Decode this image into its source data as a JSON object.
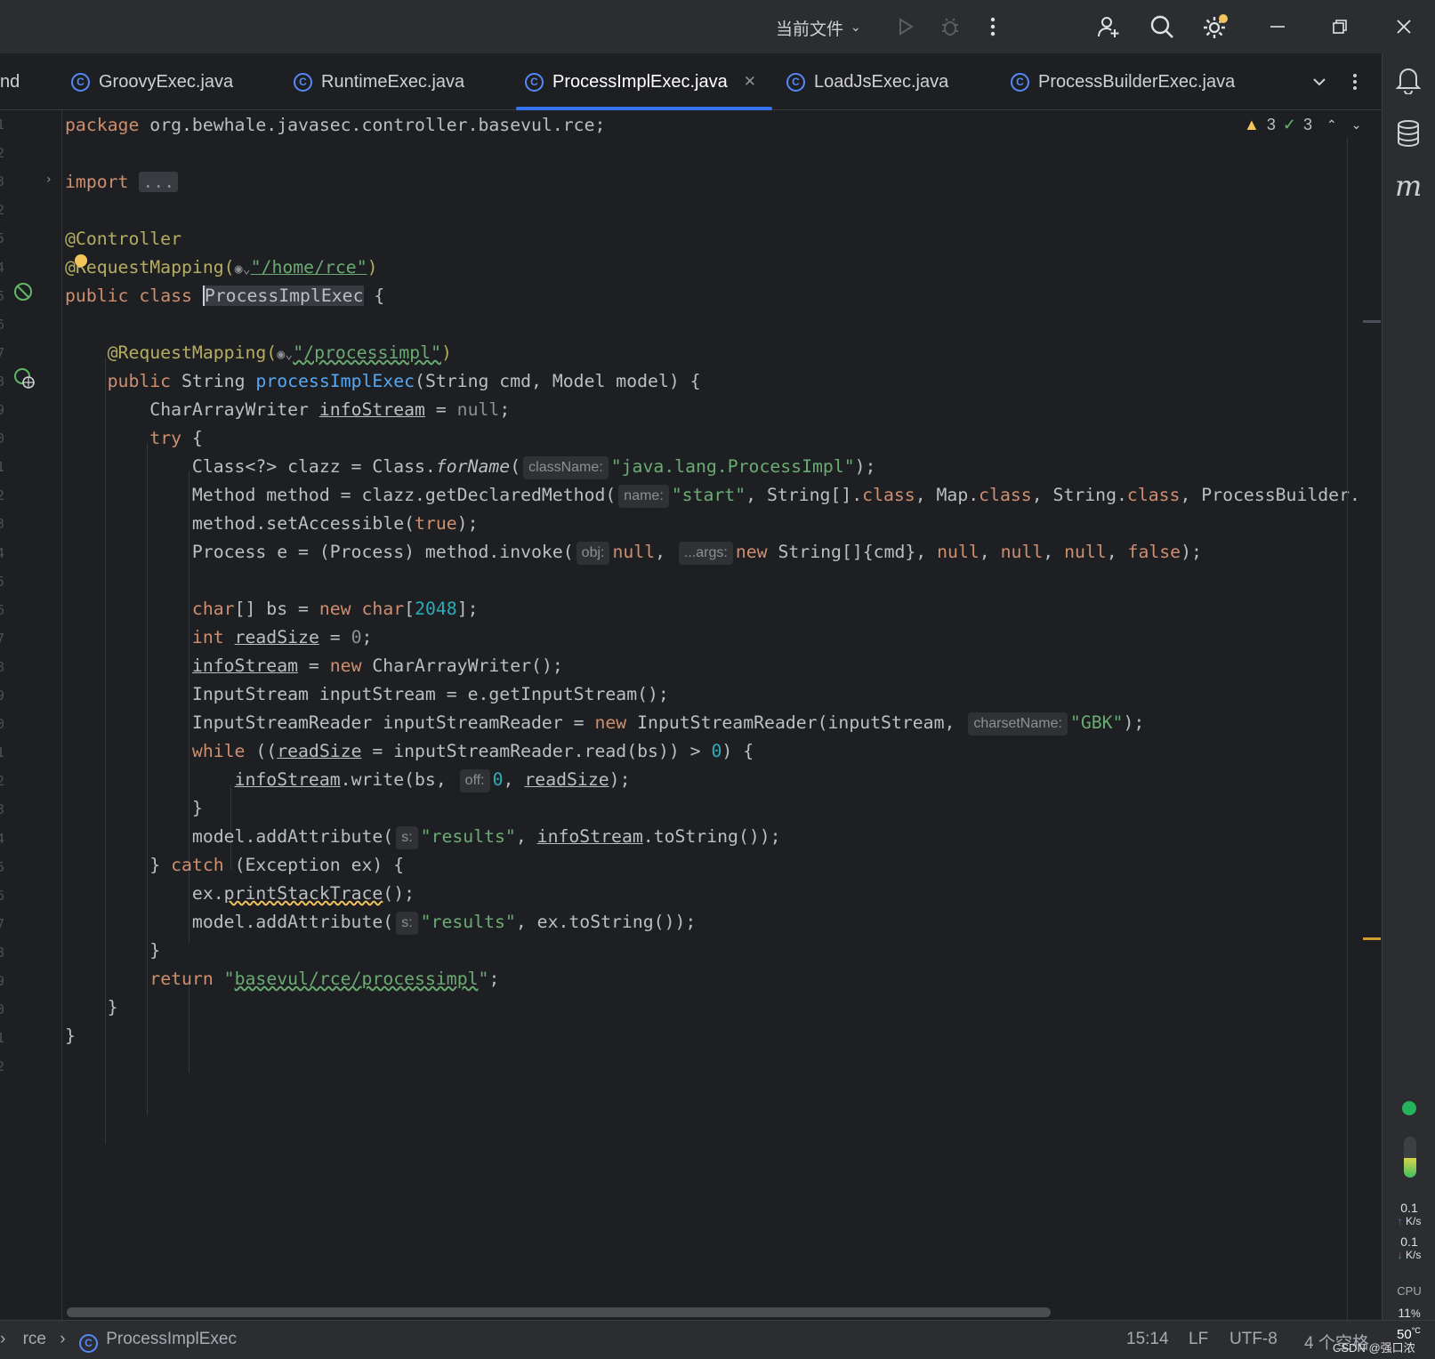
{
  "toolbar": {
    "run_config": "当前文件",
    "icons": [
      "chevron-down-icon",
      "run-icon",
      "debug-icon",
      "more-icon",
      "add-user-icon",
      "search-icon",
      "settings-icon",
      "minimize-icon",
      "restore-icon",
      "close-icon"
    ]
  },
  "tabs": [
    {
      "label": "nd",
      "partial": true
    },
    {
      "label": "GroovyExec.java"
    },
    {
      "label": "RuntimeExec.java"
    },
    {
      "label": "ProcessImplExec.java",
      "active": true
    },
    {
      "label": "LoadJsExec.java"
    },
    {
      "label": "ProcessBuilderExec.java"
    }
  ],
  "inspections": {
    "warnings": "3",
    "ok": "3"
  },
  "gutter_numbers": [
    "1",
    "2",
    "3",
    "2",
    "5",
    "4",
    "5",
    "6",
    "7",
    "8",
    "9",
    "0",
    "1",
    "2",
    "3",
    "4",
    "5",
    "6",
    "7",
    "8",
    "9",
    "0",
    "1",
    "2",
    "3",
    "4",
    "5",
    "6",
    "7",
    "8",
    "9",
    "0",
    "1",
    "2"
  ],
  "code": {
    "l1": [
      "package",
      " org.bewhale.javasec.controller.basevul.rce;"
    ],
    "l3": [
      "import",
      "..."
    ],
    "l5": "@Controller",
    "l6": [
      "@RequestMapping(",
      "\"/home/rce\"",
      ")"
    ],
    "l7": [
      "public",
      "class",
      "ProcessImplExec",
      " {"
    ],
    "l9": [
      "@RequestMapping(",
      "\"/processimpl\"",
      ")"
    ],
    "l10": [
      "public",
      " String ",
      "processImplExec",
      "(String cmd, Model model) {"
    ],
    "l11": [
      "CharArrayWriter ",
      "infoStream",
      " = ",
      "null",
      ";"
    ],
    "l12": [
      "try",
      " {"
    ],
    "l13": [
      "Class<?> clazz = Class.",
      "forName",
      "(",
      "className:",
      "\"java.lang.ProcessImpl\"",
      ");"
    ],
    "l14": [
      "Method method = clazz.getDeclaredMethod(",
      "name:",
      "\"start\"",
      ", String[].",
      "class",
      ", Map.",
      "class",
      ", String.",
      "class",
      ", ProcessBuilder."
    ],
    "l15": [
      "method.setAccessible(",
      "true",
      ");"
    ],
    "l16": [
      "Process e = (Process) method.invoke(",
      "obj:",
      "null",
      ", ",
      "...args:",
      "new",
      " String[]{cmd}, ",
      "null",
      ", ",
      "null",
      ", ",
      "null",
      ", ",
      "false",
      ");"
    ],
    "l18": [
      "char",
      "[] bs = ",
      "new",
      " ",
      "char",
      "[",
      "2048",
      "];"
    ],
    "l19": [
      "int",
      " ",
      "readSize",
      " = ",
      "0",
      ";"
    ],
    "l20": [
      "infoStream",
      " = ",
      "new",
      " CharArrayWriter();"
    ],
    "l21": "InputStream inputStream = e.getInputStream();",
    "l22": [
      "InputStreamReader inputStreamReader = ",
      "new",
      " InputStreamReader(inputStream, ",
      "charsetName:",
      "\"GBK\"",
      ");"
    ],
    "l23": [
      "while",
      " ((",
      "readSize",
      " = inputStreamReader.read(bs)) > ",
      "0",
      ") {"
    ],
    "l24": [
      "infoStream",
      ".write(bs, ",
      "off:",
      "0",
      ", ",
      "readSize",
      ");"
    ],
    "l25": "}",
    "l26": [
      "model.addAttribute(",
      "s:",
      "\"results\"",
      ", ",
      "infoStream",
      ".toString());"
    ],
    "l27": [
      "} ",
      "catch",
      " (Exception ex) {"
    ],
    "l28": [
      "ex.",
      "printStackTrace",
      "();"
    ],
    "l29": [
      "model.addAttribute(",
      "s:",
      "\"results\"",
      ", ex.toString());"
    ],
    "l30": "}",
    "l31": [
      "return",
      " ",
      "\"",
      "basevul/rce/processimpl",
      "\"",
      ";"
    ],
    "l32": "}",
    "l33": "}"
  },
  "status": {
    "breadcrumb": [
      "rce",
      "ProcessImplExec"
    ],
    "position": "15:14",
    "line_sep": "LF",
    "encoding": "UTF-8",
    "indent": "4 个空格",
    "watermark": "CSDN @强口浓"
  },
  "monitor": {
    "up_value": "0.1",
    "up_unit": "K/s",
    "down_value": "0.1",
    "down_unit": "K/s",
    "cpu_label": "CPU",
    "cpu_value": "11",
    "cpu_unit": "%",
    "temp_value": "50",
    "temp_unit": "°C"
  },
  "colors": {
    "accent": "#3574f0",
    "keyword": "#cf8e6d",
    "string": "#6aab73",
    "annotation": "#b3ae60",
    "number": "#2aacb8",
    "function": "#56a8f5"
  }
}
